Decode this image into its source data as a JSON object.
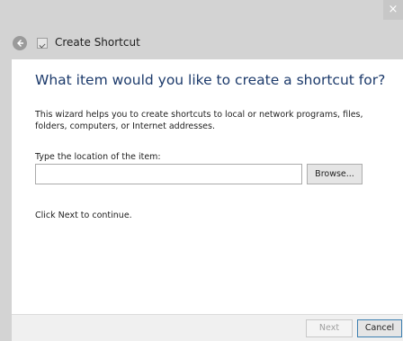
{
  "window": {
    "close_glyph": "×"
  },
  "header": {
    "title": "Create Shortcut",
    "back_icon": "back-arrow-icon",
    "app_icon": "shortcut-icon"
  },
  "content": {
    "title": "What item would you like to create a shortcut for?",
    "description": "This wizard helps you to create shortcuts to local or network programs, files, folders, computers, or Internet addresses.",
    "location_label": "Type the location of the item:",
    "location_value": "",
    "browse_label": "Browse...",
    "continue_text": "Click Next to continue."
  },
  "footer": {
    "next_label": "Next",
    "cancel_label": "Cancel"
  },
  "colors": {
    "title": "#1c3a6b",
    "chrome": "#d3d3d3",
    "accent_border": "#3c7fb1"
  }
}
